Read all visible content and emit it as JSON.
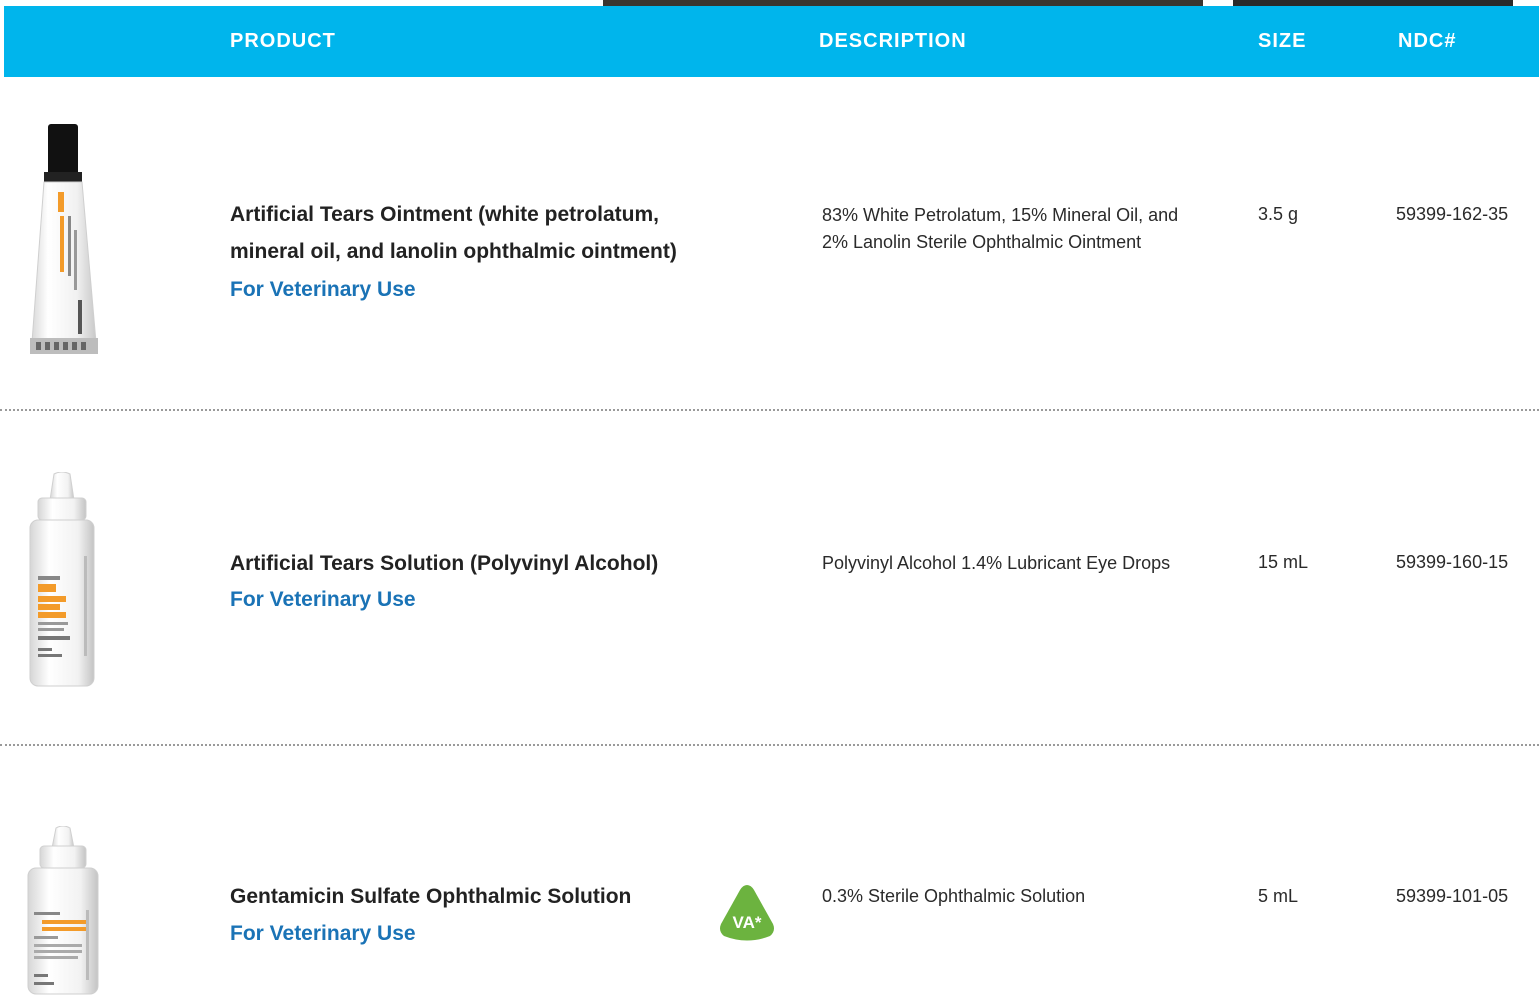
{
  "header": {
    "product": "PRODUCT",
    "description": "DESCRIPTION",
    "size": "SIZE",
    "ndc": "NDC#"
  },
  "rows": [
    {
      "name": "Artificial Tears Ointment (white petrolatum,\nmineral oil, and lanolin ophthalmic ointment)",
      "vet_use": "For Veterinary Use",
      "description": "83% White Petrolatum, 15% Mineral Oil, and\n2% Lanolin Sterile Ophthalmic Ointment",
      "size": "3.5 g",
      "ndc": "59399-162-35"
    },
    {
      "name": "Artificial Tears Solution (Polyvinyl Alcohol)",
      "vet_use": "For Veterinary Use",
      "description": "Polyvinyl Alcohol 1.4% Lubricant Eye Drops",
      "size": "15 mL",
      "ndc": "59399-160-15"
    },
    {
      "name": "Gentamicin Sulfate Ophthalmic Solution",
      "vet_use": "For Veterinary Use",
      "badge": "VA*",
      "description": "0.3% Sterile Ophthalmic Solution",
      "size": "5 mL",
      "ndc": "59399-101-05"
    }
  ],
  "colors": {
    "header_bg": "#00b5ec",
    "vet_use": "#1a73b6",
    "badge": "#6cb33f"
  }
}
